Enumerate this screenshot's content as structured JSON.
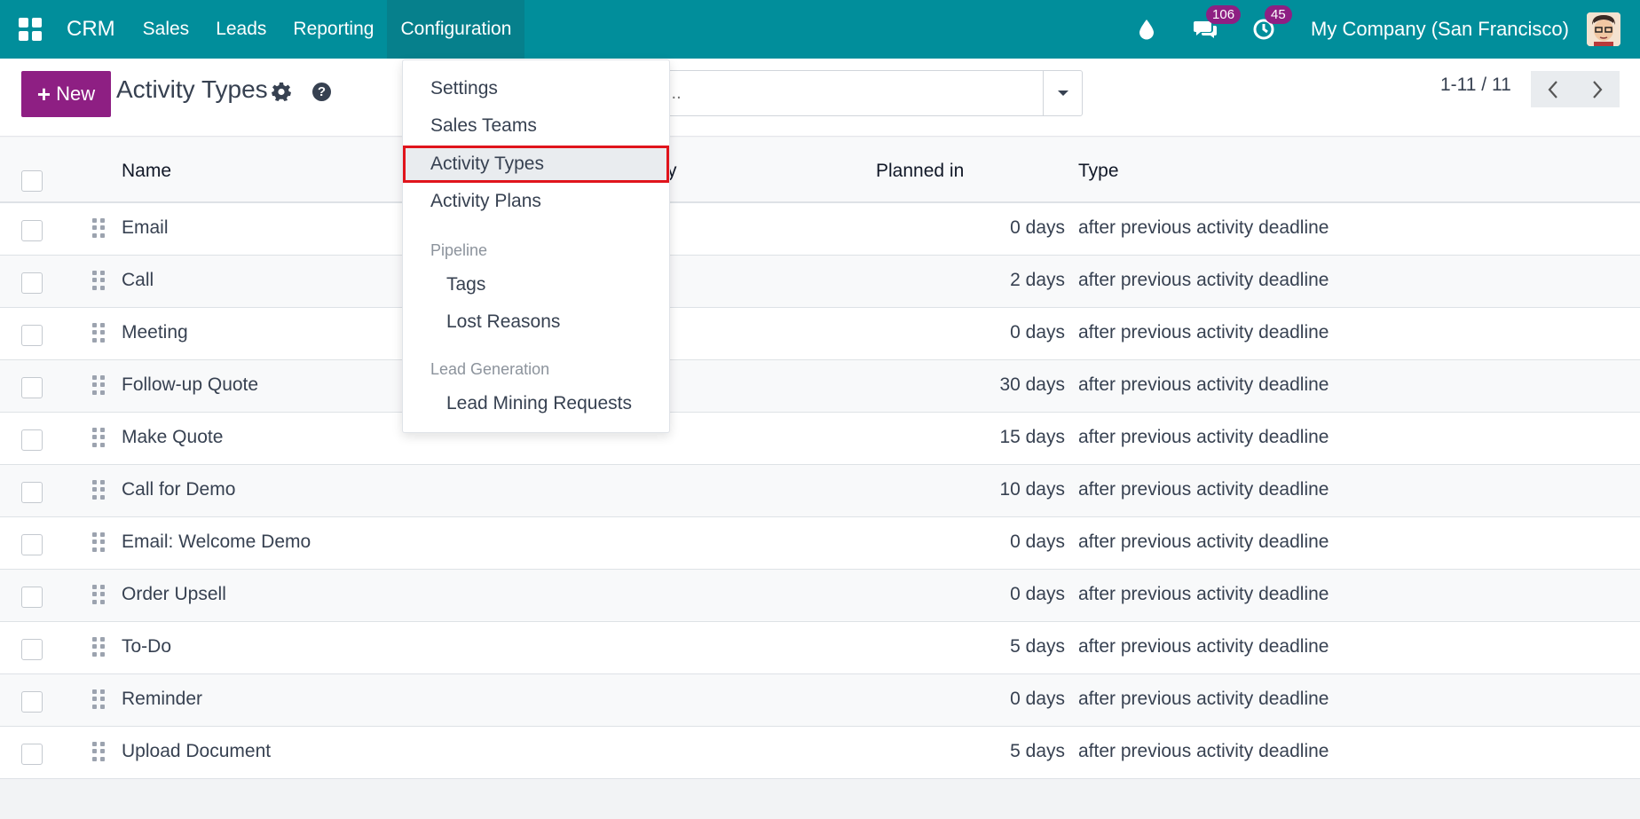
{
  "topbar": {
    "brand": "CRM",
    "nav": [
      "Sales",
      "Leads",
      "Reporting",
      "Configuration"
    ],
    "active_nav": "Configuration",
    "messages_count": "106",
    "activities_count": "45",
    "company": "My Company (San Francisco)",
    "accent_color": "#018e9b"
  },
  "controlbar": {
    "new_label": "New",
    "title": "Activity Types",
    "search_placeholder": "...",
    "pager": "1-11 / 11"
  },
  "list": {
    "columns": [
      "Name",
      "y",
      "Planned in",
      "Type"
    ],
    "rows": [
      {
        "name": "Email",
        "planned": "0 days",
        "type": "after previous activity deadline"
      },
      {
        "name": "Call",
        "planned": "2 days",
        "type": "after previous activity deadline"
      },
      {
        "name": "Meeting",
        "planned": "0 days",
        "type": "after previous activity deadline"
      },
      {
        "name": "Follow-up Quote",
        "planned": "30 days",
        "type": "after previous activity deadline"
      },
      {
        "name": "Make Quote",
        "planned": "15 days",
        "type": "after previous activity deadline"
      },
      {
        "name": "Call for Demo",
        "planned": "10 days",
        "type": "after previous activity deadline"
      },
      {
        "name": "Email: Welcome Demo",
        "planned": "0 days",
        "type": "after previous activity deadline"
      },
      {
        "name": "Order Upsell",
        "planned": "0 days",
        "type": "after previous activity deadline"
      },
      {
        "name": "To-Do",
        "planned": "5 days",
        "type": "after previous activity deadline"
      },
      {
        "name": "Reminder",
        "planned": "0 days",
        "type": "after previous activity deadline"
      },
      {
        "name": "Upload Document",
        "planned": "5 days",
        "type": "after previous activity deadline"
      }
    ]
  },
  "dropdown": {
    "items": [
      "Settings",
      "Sales Teams",
      "Activity Types",
      "Activity Plans"
    ],
    "selected": "Activity Types",
    "pipeline_header": "Pipeline",
    "pipeline_items": [
      "Tags",
      "Lost Reasons"
    ],
    "leadgen_header": "Lead Generation",
    "leadgen_items": [
      "Lead Mining Requests"
    ]
  }
}
